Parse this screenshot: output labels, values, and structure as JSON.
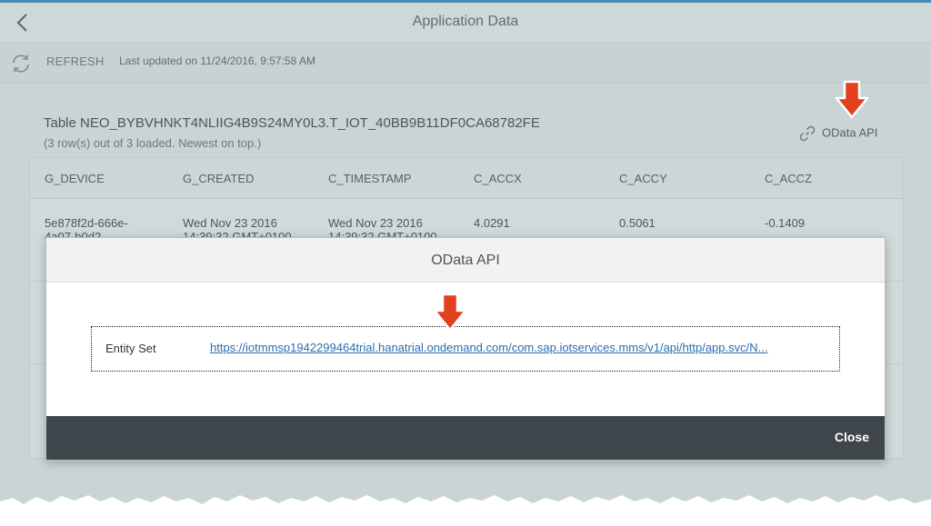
{
  "header": {
    "title": "Application Data",
    "back_icon": "chevron-left-icon"
  },
  "toolbar": {
    "refresh_label": "REFRESH",
    "last_updated": "Last updated on 11/24/2016, 9:57:58 AM"
  },
  "table": {
    "title": "Table NEO_BYBVHNKT4NLIIG4B9S24MY0L3.T_IOT_40BB9B11DF0CA68782FE",
    "rows_info": "(3 row(s) out of 3 loaded. Newest on top.)",
    "odata_link": "OData API",
    "columns": [
      "G_DEVICE",
      "G_CREATED",
      "C_TIMESTAMP",
      "C_ACCX",
      "C_ACCY",
      "C_ACCZ"
    ],
    "rows": [
      [
        "5e878f2d-666e-4a07-b0d2-",
        "Wed Nov 23 2016 14:39:32 GMT+0100",
        "Wed Nov 23 2016 14:39:32 GMT+0100",
        "4.0291",
        "0.5061",
        "-0.1409"
      ]
    ]
  },
  "dialog": {
    "title": "OData API",
    "entity_label": "Entity Set",
    "entity_url": "https://iotmmsp1942299464trial.hanatrial.ondemand.com/com.sap.iotservices.mms/v1/api/http/app.svc/N...",
    "close_label": "Close"
  },
  "colors": {
    "accent": "#2b7fc3",
    "link": "#2a6eb0",
    "footer": "#3e464c",
    "callout_arrow": "#e2401f"
  }
}
